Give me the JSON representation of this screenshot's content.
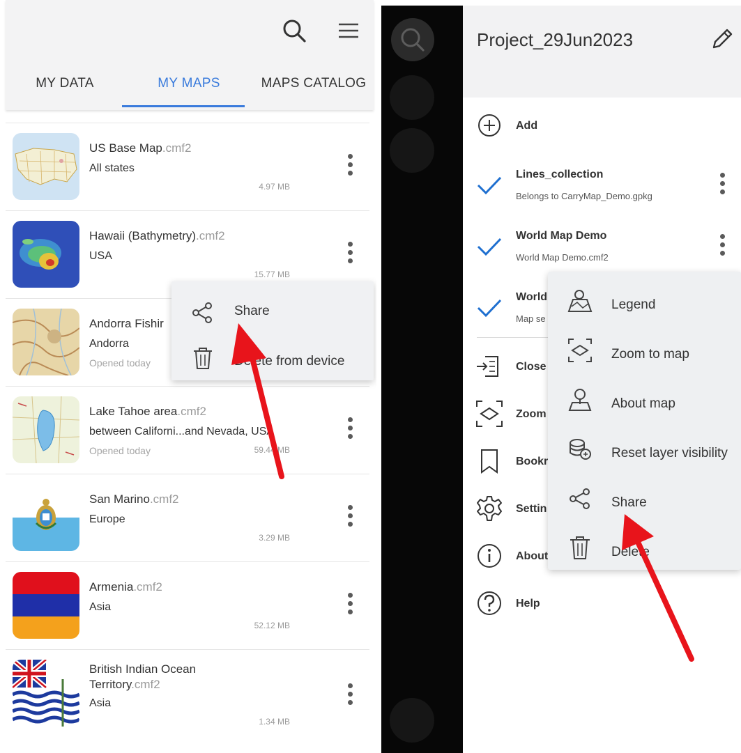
{
  "left": {
    "tabs": [
      {
        "label": "MY DATA"
      },
      {
        "label": "MY MAPS"
      },
      {
        "label": "MAPS CATALOG"
      }
    ],
    "active_tab": "MY MAPS",
    "maps": [
      {
        "name": "US Base Map",
        "ext": ".cmf2",
        "sub": "All states",
        "opened": "",
        "size": "4.97 MB"
      },
      {
        "name": "Hawaii (Bathymetry)",
        "ext": ".cmf2",
        "sub": "USA",
        "opened": "",
        "size": "15.77 MB"
      },
      {
        "name": "Andorra Fishir",
        "ext": "",
        "sub": "Andorra",
        "opened": "Opened today",
        "size": ""
      },
      {
        "name": "Lake Tahoe area",
        "ext": ".cmf2",
        "sub": "between Californi...and Nevada, USA",
        "opened": "Opened today",
        "size": "59.44 MB"
      },
      {
        "name": "San Marino",
        "ext": ".cmf2",
        "sub": "Europe",
        "opened": "",
        "size": "3.29 MB"
      },
      {
        "name": "Armenia",
        "ext": ".cmf2",
        "sub": "Asia",
        "opened": "",
        "size": "52.12 MB"
      },
      {
        "name_line1": "British Indian Ocean",
        "name": "Territory",
        "ext": ".cmf2",
        "sub": "Asia",
        "opened": "",
        "size": "1.34 MB"
      }
    ],
    "popup": {
      "share": "Share",
      "delete": "Delete from device"
    }
  },
  "right": {
    "project_name": "Project_29Jun2023",
    "add_label": "Add",
    "layers": [
      {
        "name": "Lines_collection",
        "sub": "Belongs to CarryMap_Demo.gpkg"
      },
      {
        "name": "World Map Demo",
        "sub": "World Map Demo.cmf2"
      },
      {
        "name": "World",
        "sub": "Map se"
      }
    ],
    "menu": [
      {
        "label": "Close"
      },
      {
        "label": "Zoom"
      },
      {
        "label": "Bookr"
      },
      {
        "label": "Settin"
      },
      {
        "label": "About"
      },
      {
        "label": "Help"
      }
    ],
    "popup": [
      {
        "label": "Legend",
        "icon": "legend-icon"
      },
      {
        "label": "Zoom to map",
        "icon": "zoom-to-map-icon"
      },
      {
        "label": "About map",
        "icon": "about-map-icon"
      },
      {
        "label": "Reset layer visibility",
        "icon": "layers-icon"
      },
      {
        "label": "Share",
        "icon": "share-icon"
      },
      {
        "label": "Delete",
        "icon": "trash-icon"
      }
    ]
  },
  "colors": {
    "accent": "#3a7bdc",
    "check": "#1e6fd0",
    "arrow": "#e8141b"
  }
}
